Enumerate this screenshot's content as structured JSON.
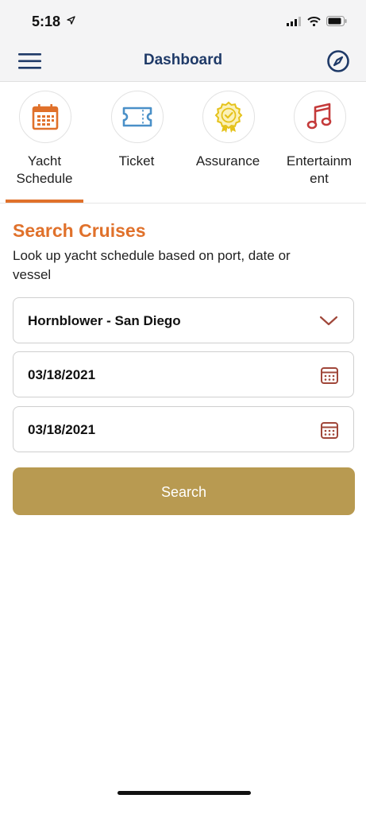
{
  "status_bar": {
    "time": "5:18",
    "icons": [
      "location-arrow-icon",
      "signal-icon",
      "wifi-icon",
      "battery-icon"
    ]
  },
  "header": {
    "title": "Dashboard",
    "left_icon": "menu-icon",
    "right_icon": "compass-icon"
  },
  "tabs": [
    {
      "label": "Yacht\nSchedule",
      "icon": "calendar-icon",
      "color": "#e0712b",
      "active": true
    },
    {
      "label": "Ticket",
      "icon": "ticket-icon",
      "color": "#4a90c8",
      "active": false
    },
    {
      "label": "Assurance",
      "icon": "badge-icon",
      "color": "#e5c21a",
      "active": false
    },
    {
      "label": "Entertainm\nent",
      "icon": "music-note-icon",
      "color": "#c43a3a",
      "active": false
    }
  ],
  "search": {
    "title": "Search Cruises",
    "description": "Look up yacht schedule based on port, date or vessel",
    "vessel_select": "Hornblower - San Diego",
    "start_date": "03/18/2021",
    "end_date": "03/18/2021",
    "button_label": "Search"
  },
  "colors": {
    "accent_orange": "#e0712b",
    "navy": "#1f3a68",
    "gold_button": "#b89a51",
    "calendar_icon": "#a0473a"
  }
}
